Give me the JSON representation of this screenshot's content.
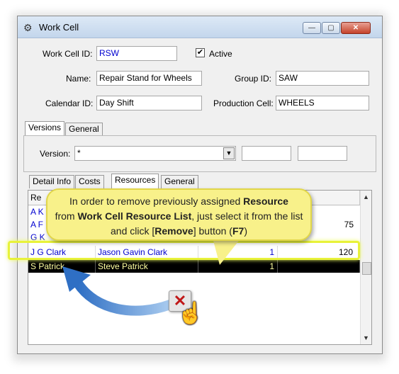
{
  "window": {
    "title": "Work Cell",
    "controls": [
      "minimize",
      "maximize",
      "close"
    ]
  },
  "form": {
    "work_cell_id_label": "Work Cell ID:",
    "work_cell_id_value": "RSW",
    "active_label": "Active",
    "active_checked": true,
    "name_label": "Name:",
    "name_value": "Repair Stand for Wheels",
    "group_id_label": "Group ID:",
    "group_id_value": "SAW",
    "calendar_id_label": "Calendar ID:",
    "calendar_id_value": "Day Shift",
    "production_cell_label": "Production Cell:",
    "production_cell_value": "WHEELS"
  },
  "outer_tabs": [
    "Versions",
    "General"
  ],
  "version": {
    "label": "Version:",
    "value": "*"
  },
  "inner_tabs": [
    "Detail Info",
    "Costs",
    "Resources",
    "General"
  ],
  "grid": {
    "headers": [
      "Re",
      "",
      "",
      "%"
    ],
    "rows": [
      {
        "code": "A K",
        "name": "",
        "qty": "",
        "pct": ""
      },
      {
        "code": "A F",
        "name": "",
        "qty": "",
        "pct": "75"
      },
      {
        "code": "G K",
        "name": "",
        "qty": "",
        "pct": ""
      },
      {
        "code": "J G Clark",
        "name": "Jason Gavin Clark",
        "qty": "1",
        "pct": "120"
      },
      {
        "code": "S Patrick",
        "name": "Steve Patrick",
        "qty": "1",
        "pct": ""
      }
    ],
    "selected_row": 4
  },
  "callout": {
    "t1": "In order to remove previously assigned ",
    "b1": "Resource",
    "t2": "from ",
    "b2": "Work Cell Resource List",
    "t3": ", just select it from the list and click [",
    "b3": "Remove",
    "t4": "] button (",
    "b4": "F7",
    "t5": ")"
  },
  "colors": {
    "selection_bg": "#000000",
    "selection_text": "#ffffa0",
    "highlight": "#e8f23a",
    "callout_bg": "#f8f18a",
    "link_text": "#0000d0",
    "arrow": "#3a7fd0"
  },
  "icons": {
    "window": "work-cell-icon",
    "remove": "remove-x-icon",
    "cursor": "hand-pointer-icon"
  }
}
